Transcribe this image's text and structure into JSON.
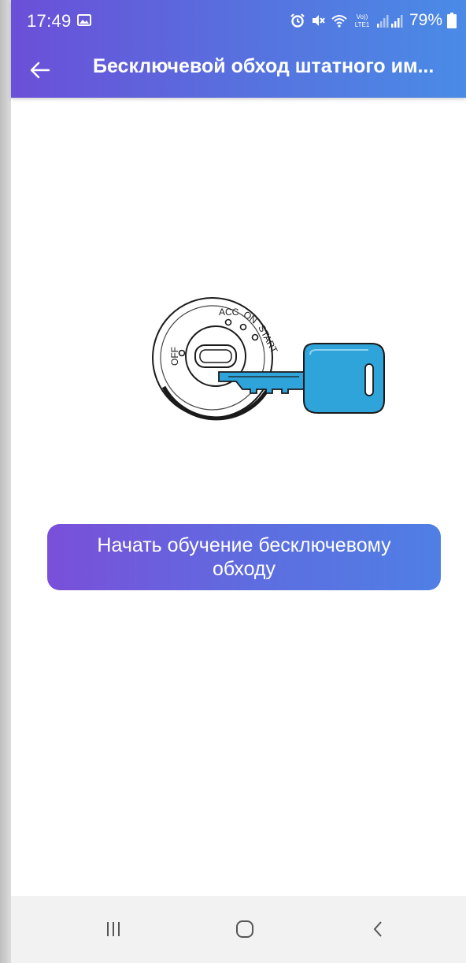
{
  "status_bar": {
    "time": "17:49",
    "network_label": "Vo) LTE1",
    "battery_percent": "79%",
    "icons": [
      "gallery-icon",
      "alarm-icon",
      "mute-icon",
      "wifi-icon",
      "volte-icon",
      "signal-icon",
      "battery-icon"
    ]
  },
  "header": {
    "back_icon": "arrow-left-icon",
    "title": "Бесключевой обход штатного им..."
  },
  "illustration": {
    "icon": "ignition-key-icon",
    "labels": {
      "acc": "ACC",
      "on": "ON",
      "start": "START",
      "off": "OFF"
    },
    "key_color": "#2fa4db"
  },
  "main": {
    "start_button_label": "Начать обучение бесключевому обходу"
  },
  "nav_bar": {
    "icons": [
      "recent-apps-icon",
      "home-icon",
      "back-icon"
    ]
  },
  "colors": {
    "header_gradient_start": "#6b4fd8",
    "header_gradient_end": "#4a8be6",
    "button_gradient_start": "#7a4fd9",
    "button_gradient_end": "#4f7fe5"
  }
}
